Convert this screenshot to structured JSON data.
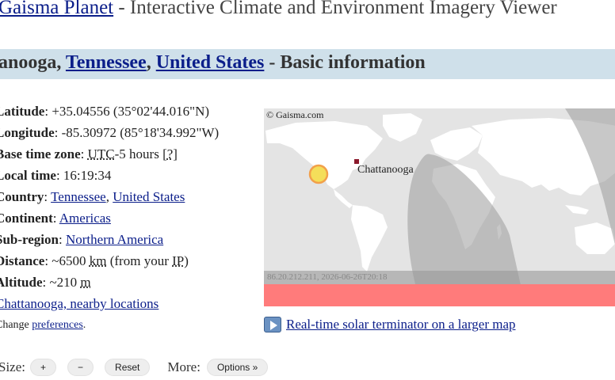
{
  "header": {
    "site_link": "Gaisma Planet",
    "subtitle": " - Interactive Climate and Environment Imagery Viewer"
  },
  "banner": {
    "city": "ttanooga",
    "sep1": ", ",
    "state": "Tennessee",
    "sep2": ", ",
    "country": "United States",
    "suffix": " - Basic information"
  },
  "info": {
    "latitude_label": "Latitude",
    "latitude_value": ": +35.04556 (35°02'44.016\"N)",
    "longitude_label": "Longitude",
    "longitude_value": ": -85.30972 (85°18'34.992\"W)",
    "tz_label": "Base time zone",
    "tz_sep": ": ",
    "tz_abbr": "UTC",
    "tz_value": "-5 hours [",
    "tz_help": "?",
    "tz_close": "]",
    "local_label": "Local time",
    "local_value": ": 16:19:34",
    "country_label": "Country",
    "country_sep": ": ",
    "country_state": "Tennessee",
    "country_comma": ", ",
    "country_country": "United States",
    "continent_label": "Continent",
    "continent_sep": ": ",
    "continent_value": "Americas",
    "subregion_label": "Sub-region",
    "subregion_sep": ": ",
    "subregion_value": "Northern America",
    "distance_label": "Distance",
    "distance_value": ": ~6500 ",
    "distance_unit": "km",
    "distance_mid": " (from your ",
    "distance_ip": "IP",
    "distance_end": ")",
    "altitude_label": "Altitude",
    "altitude_value": ": ~210 ",
    "altitude_unit": "m",
    "nearby_link": "Chattanooga, nearby locations",
    "change_text": "Change ",
    "preferences_link": "preferences",
    "change_end": "."
  },
  "map": {
    "copyright": "© Gaisma.com",
    "city_label": "Chattanooga",
    "stamp": "86.20.212.211, 2026-06-26T20:18",
    "land_color": "#ffffff",
    "ocean_color": "#e4e4e4",
    "night_color": "#9a9a9a",
    "sun_color": "#f4de5a",
    "bar_color": "#ff7b7b",
    "city_marker_color": "#8b1a2c"
  },
  "realtime_link": "Real-time solar terminator on a larger map",
  "controls": {
    "size_label": "Size:",
    "plus": "+",
    "minus": "−",
    "reset": "Reset",
    "more_label": "More:",
    "options": "Options »"
  }
}
